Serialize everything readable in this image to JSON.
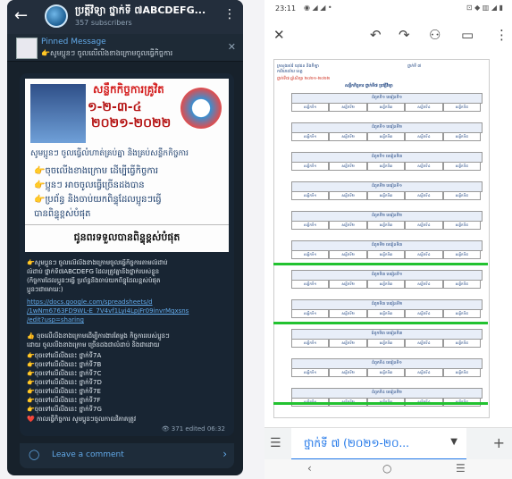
{
  "telegram": {
    "channel_title": "ប្រត្តីវិទ្យា ថ្នាក់ទី ៧ABCDEFG...",
    "subscribers": "357 subscribers",
    "pinned": {
      "label": "Pinned Message",
      "text": "👉សូមប្អូនៗ ចូលលើលីងខាងក្រោមចូលធ្វើកិច្ចការ"
    },
    "poster": {
      "title": "សន្លឹកកិច្ចការគ្រូវិត",
      "year_line1": "១-២-៣-៤",
      "year_line2": "២០២១-២០២២",
      "line1": "សូមប្អូនៗ ចូលធ្វើលំហាត់គ្រប់គ្នា និងគ្រប់សន្លឹកកិច្ចការ",
      "bullets": [
        "👉ចុចលើងខាងក្រោម ដើម្បីធ្វើកិច្ចការ",
        "👉ប្អូនៗ អាចចូលធ្វើច្រើនដងបាន",
        "👉ប្រព័ន្ធ និងចាប់យកពិន្ទុដែលប្អូនៗធ្វើ",
        "   បានពិន្ទុខ្ពស់បំផុត"
      ],
      "footer": "ជូនពរទទួលបានពិន្ទុខ្ពស់បំផុត"
    },
    "message_lines": [
      "👉សូមប្អូនៗ ចូលលើលីងខាងក្រោមចូលធ្វើកិច្ចការតាមលំដាប់",
      "លំដាប់ ថ្នាក់ទី៧ABCDEFG ដែលត្រូវគ្នានឹងថ្នាក់របស់ខ្លួន",
      "(កិច្ចការដែលប្អូនៗធ្វើ ប្រព័ន្ធនឹងចាប់យកពិន្ទុដែលខ្ពស់បំផុត",
      "ប្អូនៗជាមោឃៈ)"
    ],
    "link_lines": [
      "https://docs.google.com/spreadsheets/d",
      "/1wNm6763FD9WL-E_7V4vf1Lyi4LpjFr09invrMqxsns",
      "/edit?usp=sharing"
    ],
    "class_lines": [
      "👍 ចុចលើលីងខាងក្រោមដើម្បីការងារតែម្តង កិច្ចការរបស់ប្អូនៗ",
      "ដោយ ចូលលីងខាងក្រោម ច្រើនដងជាលំដាប់ និងជាដោយ",
      "👉ចុចទៅលើលីងនេះ ថ្នាក់ទី7A",
      "👉ចុចទៅលើលីងនេះ ថ្នាក់ទី7B",
      "👉ចុចទៅលើលីងនេះ ថ្នាក់ទី7C",
      "👉ចុចទៅលើលីងនេះ ថ្នាក់ទី7D",
      "👉ចុចទៅលើលីងនេះ ថ្នាក់ទី7E",
      "👉ចុចទៅលើលីងនេះ ថ្នាក់ទី7F",
      "👉ចុចទៅលើលីងនេះ ថ្នាក់ទី7G",
      "❤️ កាលធ្វើកិច្ចការ សូមប្អូនៗចូលកាលវិភាគត្រូវ"
    ],
    "views": "👁 371",
    "edited": "edited 06:32",
    "comment_label": "Leave a comment",
    "icons": {
      "back": "back-arrow-icon",
      "more": "more-vertical-icon",
      "close": "close-icon",
      "comment": "comment-icon",
      "chevron": "chevron-right-icon"
    }
  },
  "sheets": {
    "status_time": "23:11",
    "status_icons": "◉ ◢ ◢ •",
    "status_right": "⊡ ◆ ▥ ◢ ▮",
    "doc_header_lines": [
      "ក្រសួងអប់រំ យុវជន និងកីឡា",
      "ការិយាល័យ ខេត្ត",
      "ថ្នាក់ទី ៧"
    ],
    "doc_red": "ថ្នាក់ទី៧ ឆ្នាំសិក្សា ២០២១-២០២២",
    "doc_title": "សន្លឹកកិច្ចការ ថ្នាក់ទី៧ ប្រវត្តិវិទ្យា",
    "row_titles": [
      "ជំពូកទី១ មេរៀនទី១",
      "ជំពូកទី១ មេរៀនទី២",
      "ជំពូកទី១ មេរៀនទី៣",
      "ជំពូកទី២ មេរៀនទី១",
      "ជំពូកទី២ មេរៀនទី២",
      "ជំពូកទី២ មេរៀនទី៣",
      "ជំពូកទី៣ មេរៀនទី១",
      "ជំពូកទី៣ មេរៀនទី២",
      "ជំពូកទី៣ មេរៀនទី៣",
      "ជំពូកទី៤ មេរៀនទី១",
      "ជំពូកទី៤ មេរៀនទី២"
    ],
    "cell_labels": [
      "សន្លឹកទី១",
      "សន្លឹកទី២",
      "សន្លឹកទី៣",
      "សន្លឹកទី៤",
      "សន្លឹកទី៥"
    ],
    "tab_label": "ថ្នាក់ទី ៧ (២០២១-២០...",
    "icons": {
      "close": "close-icon",
      "undo": "undo-icon",
      "redo": "redo-icon",
      "add_person": "add-person-icon",
      "comment": "comment-icon",
      "more": "more-vertical-icon",
      "menu": "menu-icon",
      "add": "add-icon",
      "back": "nav-back-icon",
      "home": "nav-home-icon",
      "recents": "nav-recents-icon"
    }
  }
}
